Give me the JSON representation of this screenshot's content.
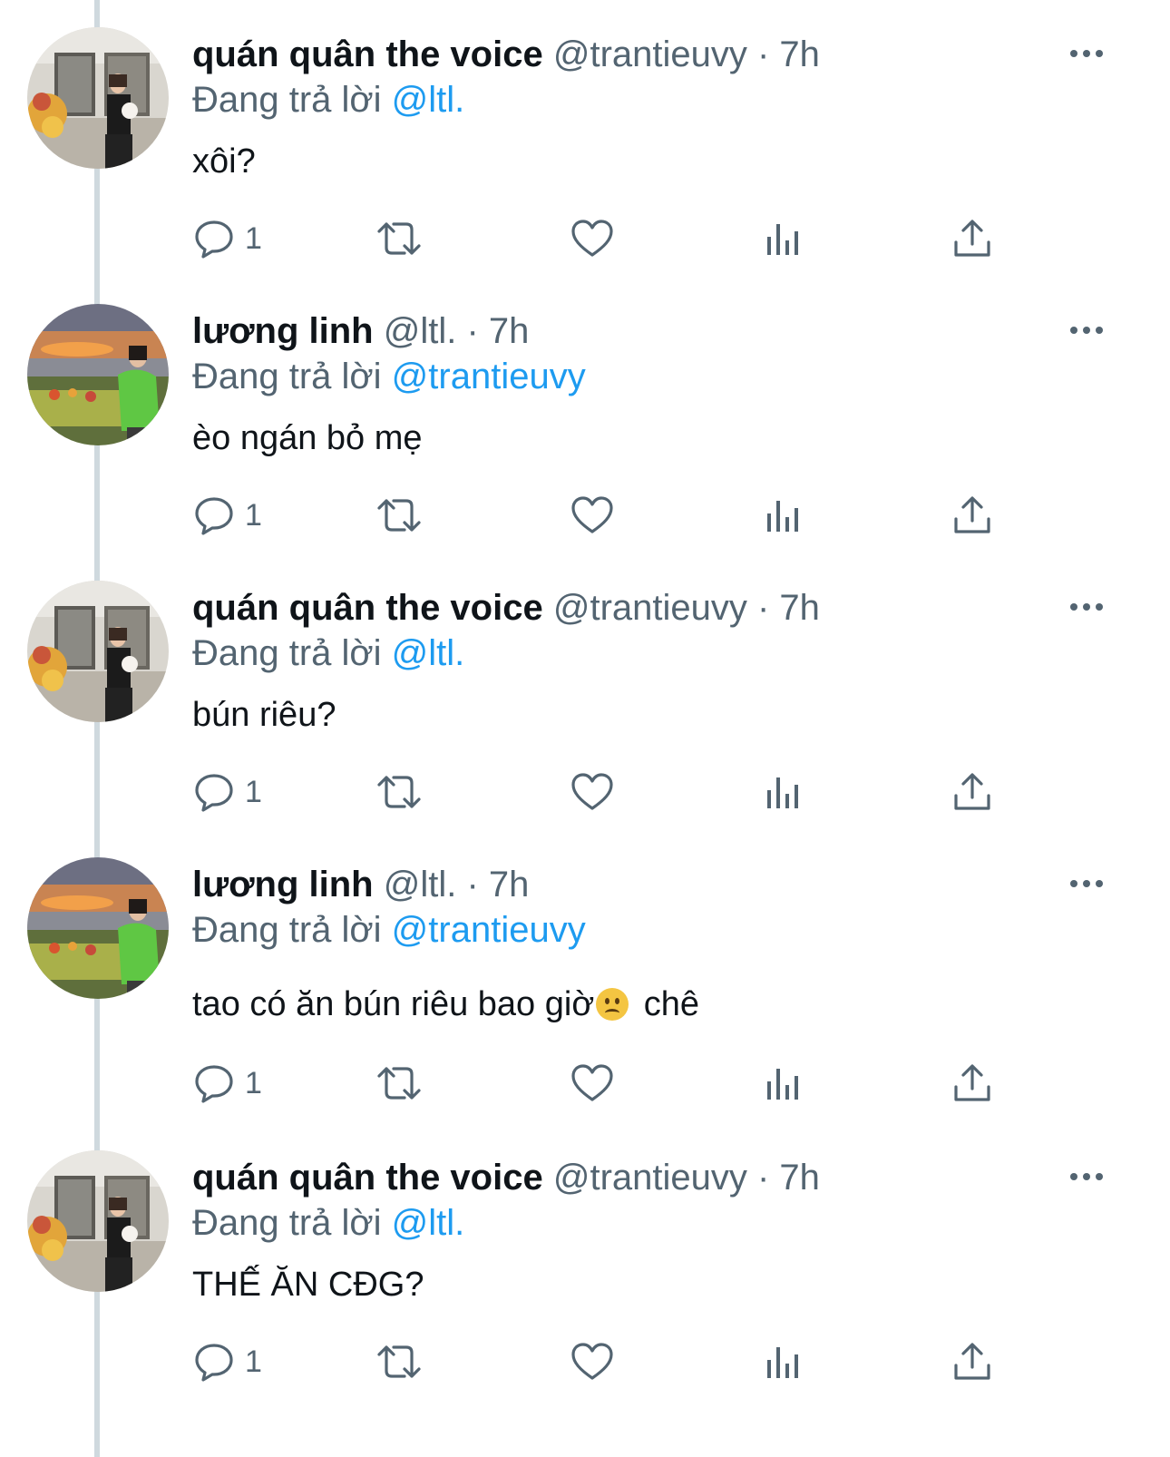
{
  "tweets": [
    {
      "name": "quán quân the voice",
      "handle": "@trantieuvy",
      "time": "· 7h",
      "replying_prefix": "Đang trả lời",
      "replying_to": "@ltl.",
      "text": "xôi?",
      "emoji": "",
      "text_after": "",
      "reply_count": "1",
      "avatar": "user-photo-storefront"
    },
    {
      "name": "lương linh",
      "handle": "@ltl.",
      "time": "· 7h",
      "replying_prefix": "Đang trả lời",
      "replying_to": "@trantieuvy",
      "text": "èo ngán bỏ mẹ",
      "emoji": "",
      "text_after": "",
      "reply_count": "1",
      "avatar": "user-photo-sunset"
    },
    {
      "name": "quán quân the voice",
      "handle": "@trantieuvy",
      "time": "· 7h",
      "replying_prefix": "Đang trả lời",
      "replying_to": "@ltl.",
      "text": "bún riêu?",
      "emoji": "",
      "text_after": "",
      "reply_count": "1",
      "avatar": "user-photo-storefront"
    },
    {
      "name": "lương linh",
      "handle": "@ltl.",
      "time": "· 7h",
      "replying_prefix": "Đang trả lời",
      "replying_to": "@trantieuvy",
      "text": "tao có ăn bún riêu bao giờ",
      "emoji": "🙁",
      "text_after": " chê",
      "reply_count": "1",
      "avatar": "user-photo-sunset"
    },
    {
      "name": "quán quân the voice",
      "handle": "@trantieuvy",
      "time": "· 7h",
      "replying_prefix": "Đang trả lời",
      "replying_to": "@ltl.",
      "text": "THẾ ĂN CĐG?",
      "emoji": "",
      "text_after": "",
      "reply_count": "1",
      "avatar": "user-photo-storefront"
    }
  ],
  "icons": {
    "more": "more-horizontal-icon",
    "reply": "reply-bubble-icon",
    "retweet": "retweet-icon",
    "like": "heart-icon",
    "views": "views-bar-chart-icon",
    "share": "share-upload-icon"
  },
  "colors": {
    "text": "#0f1419",
    "secondary": "#536471",
    "mention": "#1d9bf0",
    "thread_line": "#cfd9de"
  }
}
